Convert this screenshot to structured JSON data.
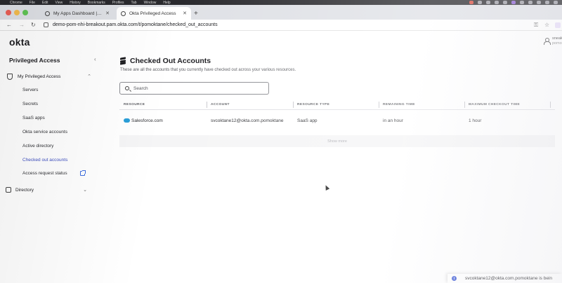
{
  "menubar": {
    "items": [
      "Chrome",
      "File",
      "Edit",
      "View",
      "History",
      "Bookmarks",
      "Profiles",
      "Tab",
      "Window",
      "Help"
    ]
  },
  "browser": {
    "tabs": [
      {
        "label": "My Apps Dashboard | demo-p"
      },
      {
        "label": "Okta Privileged Access"
      }
    ],
    "url": "demo-pom-nhi-breakout.pam.okta.com/t/pomoktane/checked_out_accounts"
  },
  "header": {
    "logo": "okta",
    "user_name": "sneak",
    "user_org": "pomok"
  },
  "sidebar": {
    "title": "Privileged Access",
    "group": "My Privileged Access",
    "items": [
      {
        "label": "Servers"
      },
      {
        "label": "Secrets"
      },
      {
        "label": "SaaS apps"
      },
      {
        "label": "Okta service accounts"
      },
      {
        "label": "Active directory"
      },
      {
        "label": "Checked out accounts"
      },
      {
        "label": "Access request status"
      }
    ],
    "directory": "Directory"
  },
  "main": {
    "title": "Checked Out Accounts",
    "subtitle": "These are all the accounts that you currently have checked out across your various resources.",
    "search_placeholder": "Search",
    "columns": [
      "RESOURCE",
      "ACCOUNT",
      "RESOURCE TYPE",
      "REMAINING TIME",
      "MAXIMUM CHECKOUT TIME"
    ],
    "rows": [
      {
        "resource": "Salesforce.com",
        "account": "svcoktane12@okta.com.pomoktane",
        "resource_type": "SaaS app",
        "remaining_time": "in an hour",
        "max_checkout_time": "1 hour"
      }
    ],
    "show_more": "Show more"
  },
  "toast": {
    "text": "svcoktane12@okta.com.pomoktane is bein"
  },
  "colors": {
    "accent": "#3d4ec0",
    "salesforce": "#2a9fd8",
    "info": "#3d5ad6"
  }
}
